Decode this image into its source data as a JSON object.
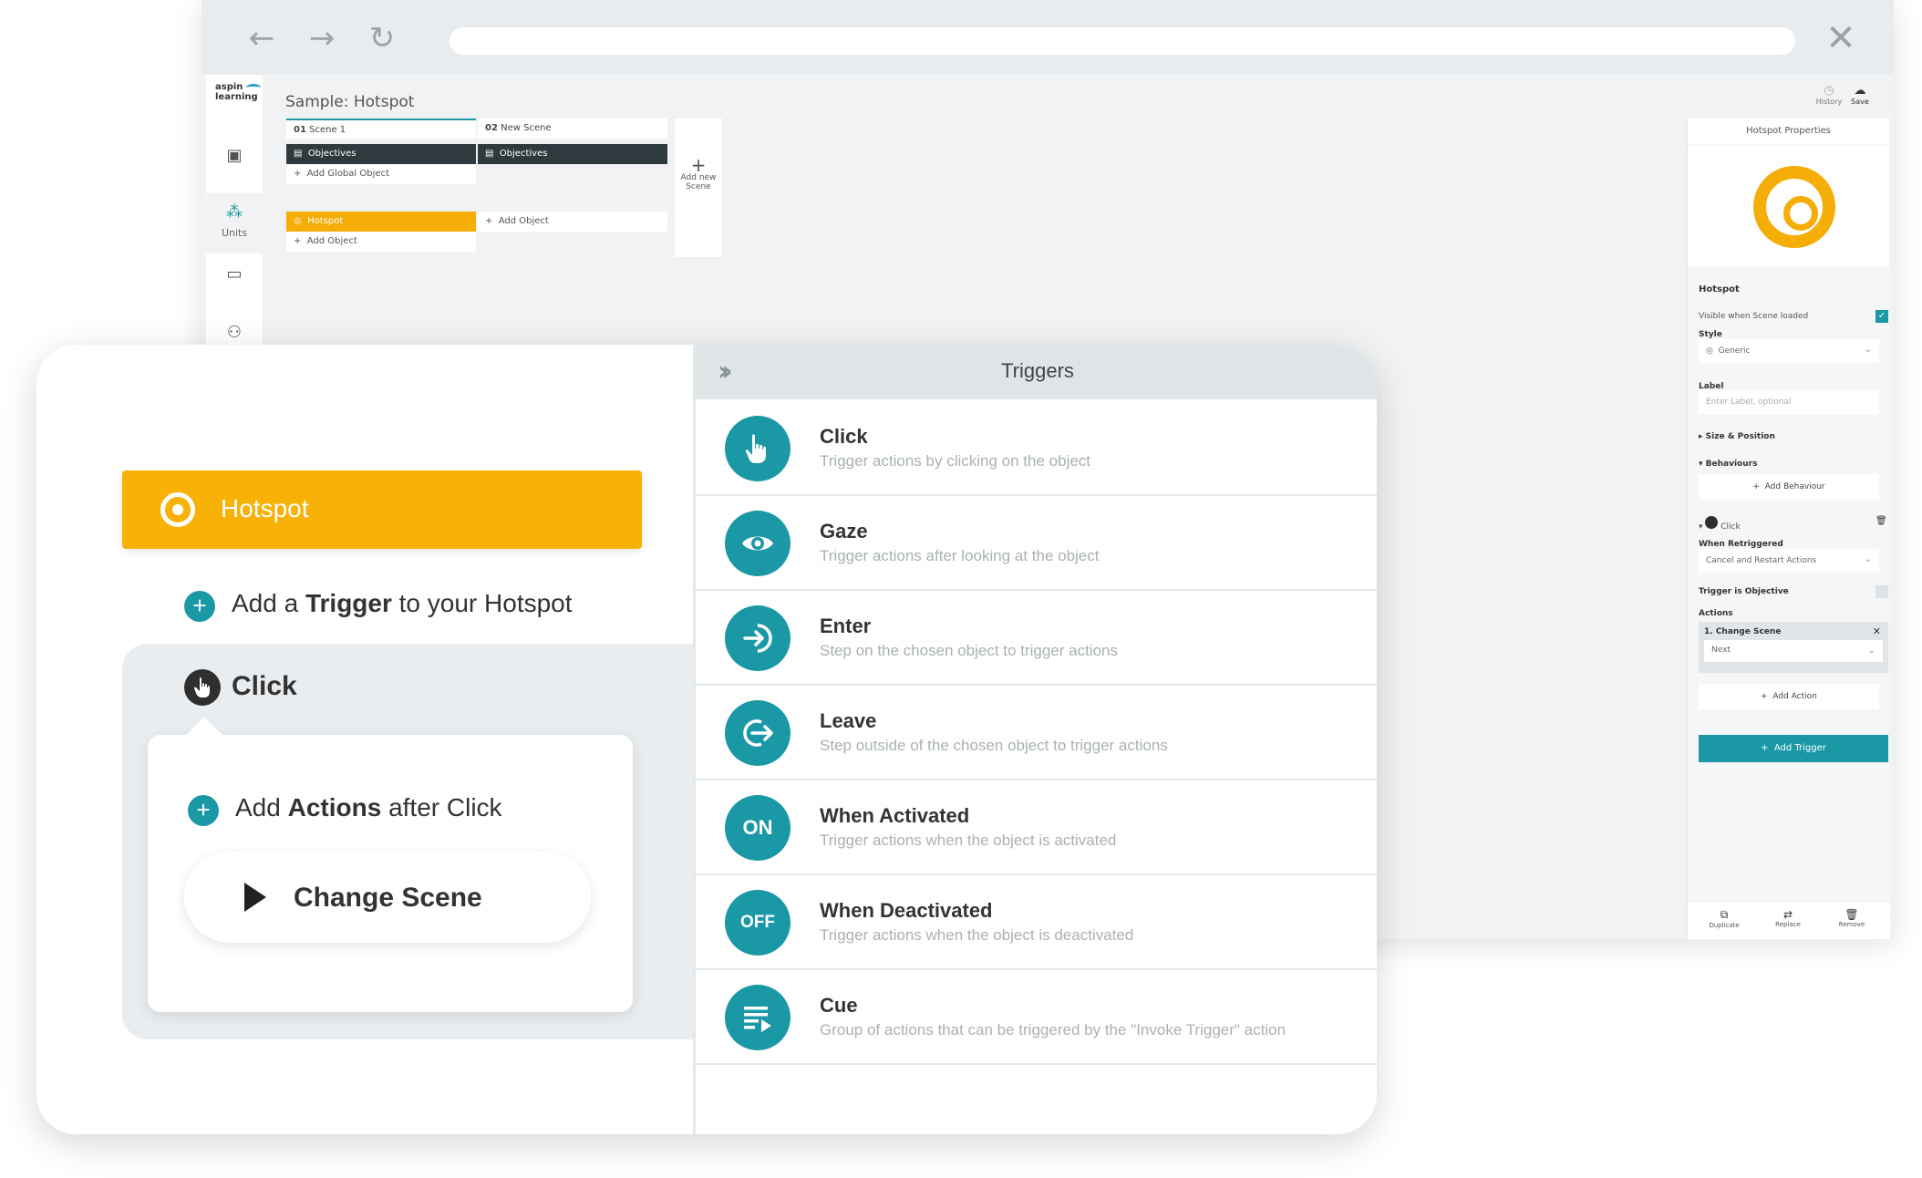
{
  "browser": {
    "back_glyph": "←",
    "forward_glyph": "→",
    "reload_glyph": "↻",
    "close_glyph": "✕"
  },
  "app": {
    "logo_line1": "aspin",
    "logo_line2": "learning",
    "title": "Sample: Hotspot",
    "left_nav": [
      {
        "icon": "book-icon",
        "label": ""
      },
      {
        "icon": "units-icon",
        "label": "Units"
      },
      {
        "icon": "folder-icon",
        "label": ""
      },
      {
        "icon": "users-icon",
        "label": ""
      }
    ],
    "scenes": [
      {
        "number": "01",
        "name": "Scene 1",
        "global_object": "Objectives",
        "add_global": "Add Global Object",
        "object": "Hotspot",
        "add_object": "Add Object"
      },
      {
        "number": "02",
        "name": "New Scene",
        "global_object": "Objectives",
        "add_object": "Add Object"
      }
    ],
    "add_scene_label": "Add new Scene",
    "tools": {
      "history": "History",
      "save": "Save"
    }
  },
  "props": {
    "header": "Hotspot Properties",
    "object_name": "Hotspot",
    "visible_label": "Visible when Scene loaded",
    "style_label": "Style",
    "style_value": "Generic",
    "label_label": "Label",
    "label_placeholder": "Enter Label, optional",
    "size_position": "Size & Position",
    "behaviours": "Behaviours",
    "add_behaviour": "Add Behaviour",
    "trigger_name": "Click",
    "when_retriggered": "When Retriggered",
    "retrigger_value": "Cancel and Restart Actions",
    "trigger_objective": "Trigger is Objective",
    "actions_label": "Actions",
    "action_item": "1. Change Scene",
    "action_value": "Next",
    "add_action": "Add Action",
    "add_trigger": "Add Trigger",
    "bottom": {
      "duplicate": "Duplicate",
      "replace": "Replace",
      "remove": "Remove"
    },
    "accent": "#1a98a6"
  },
  "card": {
    "hotspot_label": "Hotspot",
    "add_trigger_pre": "Add a ",
    "add_trigger_bold": "Trigger",
    "add_trigger_post": " to your Hotspot",
    "click_label": "Click",
    "add_actions_pre": "Add ",
    "add_actions_bold": "Actions",
    "add_actions_post": " after Click",
    "change_scene": "Change Scene",
    "hotspot_color": "#f8b106"
  },
  "triggers": {
    "title": "Triggers",
    "items": [
      {
        "name": "Click",
        "desc": "Trigger actions by clicking on the object",
        "icon": "click-hand-icon",
        "badge": ""
      },
      {
        "name": "Gaze",
        "desc": "Trigger actions after looking at the object",
        "icon": "eye-icon",
        "badge": ""
      },
      {
        "name": "Enter",
        "desc": "Step on the chosen object to trigger actions",
        "icon": "enter-icon",
        "badge": ""
      },
      {
        "name": "Leave",
        "desc": "Step outside of the chosen object to trigger actions",
        "icon": "leave-icon",
        "badge": ""
      },
      {
        "name": "When Activated",
        "desc": "Trigger actions when the object is activated",
        "icon": "on-icon",
        "badge": "ON"
      },
      {
        "name": "When Deactivated",
        "desc": "Trigger actions when the object is deactivated",
        "icon": "off-icon",
        "badge": "OFF"
      },
      {
        "name": "Cue",
        "desc": "Group of actions that can be triggered by the \"Invoke Trigger\" action",
        "icon": "cue-icon",
        "badge": ""
      }
    ]
  }
}
